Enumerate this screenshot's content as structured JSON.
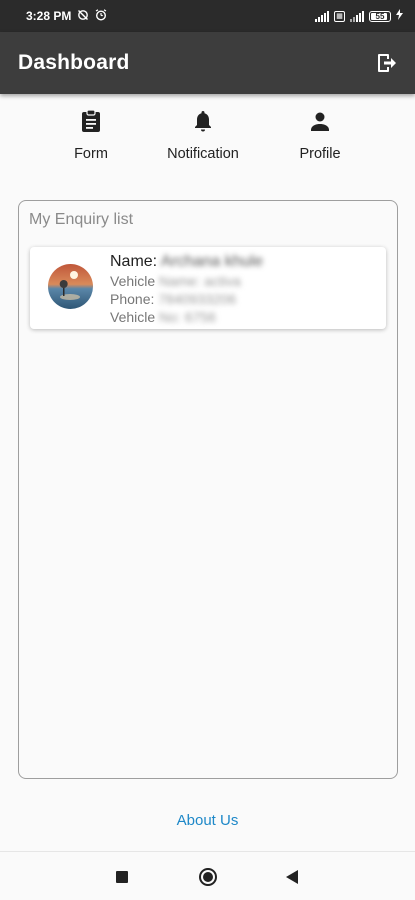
{
  "status_bar": {
    "time": "3:28 PM",
    "battery_level": "55"
  },
  "app_bar": {
    "title": "Dashboard",
    "logout_icon": "logout-icon"
  },
  "tabs": [
    {
      "label": "Form",
      "icon": "clipboard-icon"
    },
    {
      "label": "Notification",
      "icon": "bell-icon"
    },
    {
      "label": "Profile",
      "icon": "person-icon"
    }
  ],
  "enquiry_list": {
    "title": "My Enquiry list",
    "items": [
      {
        "name_label": "Name:",
        "name_value": "Archana khule",
        "vehicle_name_label": "Vehicle",
        "vehicle_name_value": "Name: activa",
        "phone_label": "Phone:",
        "phone_value": "7840933206",
        "vehicle_no_label": "Vehicle",
        "vehicle_no_value": "No: 6756"
      }
    ]
  },
  "footer": {
    "about_us": "About Us"
  },
  "colors": {
    "app_bar": "#3d3d3d",
    "status_bar": "#2b2b2b",
    "link": "#1e88c8",
    "background": "#fafafa"
  }
}
